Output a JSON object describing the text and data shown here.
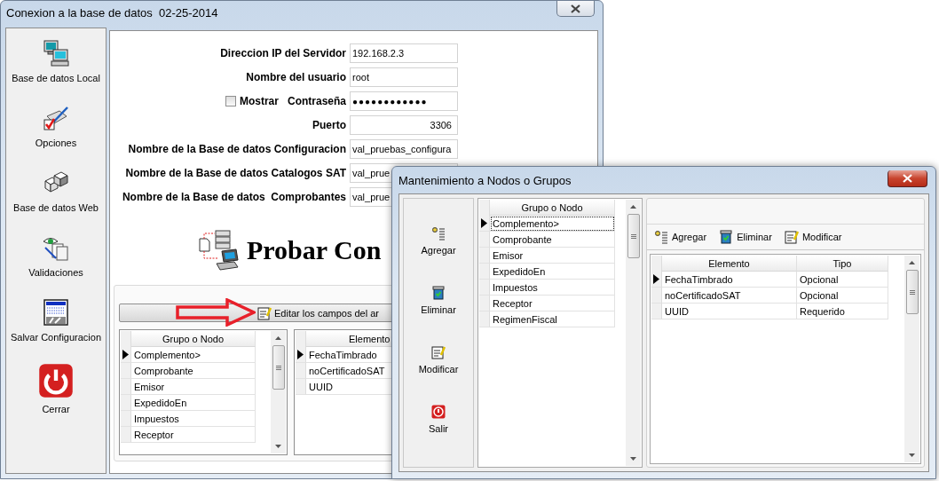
{
  "main_window": {
    "title": "Conexion a la base de datos  02-25-2014",
    "sidebar": [
      {
        "label": "Base de datos Local",
        "kind": "local"
      },
      {
        "label": "Opciones",
        "kind": "options"
      },
      {
        "label": "Base de datos Web",
        "kind": "web"
      },
      {
        "label": "Validaciones",
        "kind": "validation"
      },
      {
        "label": "Salvar Configuracion",
        "kind": "save"
      },
      {
        "label": "Cerrar",
        "kind": "close"
      }
    ],
    "form": [
      {
        "label": "Direccion IP del Servidor",
        "value": "192.168.2.3",
        "kind": "text"
      },
      {
        "label": "Nombre del usuario",
        "value": "root",
        "kind": "text"
      },
      {
        "label": "Contraseña",
        "value": "●●●●●●●●●●●●",
        "kind": "password",
        "toggle": {
          "label": "Mostrar",
          "checked": false
        }
      },
      {
        "label": "Puerto",
        "value": "3306",
        "kind": "number"
      },
      {
        "label": "Nombre de la Base de datos Configuracion",
        "value": "val_pruebas_configura",
        "kind": "text"
      },
      {
        "label": "Nombre de la Base de datos Catalogos SAT",
        "value": "val_prue",
        "kind": "text"
      },
      {
        "label": "Nombre de la Base de datos  Comprobantes",
        "value": "val_prue",
        "kind": "text"
      }
    ],
    "test_button": {
      "label": "Probar Con"
    },
    "edit_button": {
      "label": "Editar los campos del ar"
    },
    "groups_grid": {
      "columns": [
        "Grupo o Nodo"
      ],
      "rows": [
        {
          "cells": [
            "Complemento>"
          ],
          "selected": true
        },
        {
          "cells": [
            "Comprobante"
          ],
          "selected": false
        },
        {
          "cells": [
            "Emisor"
          ],
          "selected": false
        },
        {
          "cells": [
            "ExpedidoEn"
          ],
          "selected": false
        },
        {
          "cells": [
            "Impuestos"
          ],
          "selected": false
        },
        {
          "cells": [
            "Receptor"
          ],
          "selected": false
        }
      ]
    },
    "elements_grid": {
      "columns": [
        "Elemento"
      ],
      "rows": [
        {
          "cells": [
            "FechaTimbrado"
          ],
          "selected": true
        },
        {
          "cells": [
            "noCertificadoSAT"
          ],
          "selected": false
        },
        {
          "cells": [
            "UUID"
          ],
          "selected": false
        }
      ]
    }
  },
  "dialog": {
    "title": "Mantenimiento a Nodos o Grupos",
    "sidebar": [
      {
        "label": "Agregar",
        "kind": "add"
      },
      {
        "label": "Eliminar",
        "kind": "delete"
      },
      {
        "label": "Modificar",
        "kind": "edit"
      },
      {
        "label": "Salir",
        "kind": "exit"
      }
    ],
    "groups_grid": {
      "columns": [
        "Grupo o Nodo"
      ],
      "rows": [
        {
          "cells": [
            "Complemento>"
          ],
          "selected": true
        },
        {
          "cells": [
            "Comprobante"
          ],
          "selected": false
        },
        {
          "cells": [
            "Emisor"
          ],
          "selected": false
        },
        {
          "cells": [
            "ExpedidoEn"
          ],
          "selected": false
        },
        {
          "cells": [
            "Impuestos"
          ],
          "selected": false
        },
        {
          "cells": [
            "Receptor"
          ],
          "selected": false
        },
        {
          "cells": [
            "RegimenFiscal"
          ],
          "selected": false
        }
      ]
    },
    "toolbar": [
      {
        "label": "Agregar",
        "kind": "add"
      },
      {
        "label": "Eliminar",
        "kind": "delete"
      },
      {
        "label": "Modificar",
        "kind": "edit"
      }
    ],
    "elements_grid": {
      "columns": [
        "Elemento",
        "Tipo"
      ],
      "rows": [
        {
          "cells": [
            "FechaTimbrado",
            "Opcional"
          ],
          "selected": true
        },
        {
          "cells": [
            "noCertificadoSAT",
            "Opcional"
          ],
          "selected": false
        },
        {
          "cells": [
            "UUID",
            "Requerido"
          ],
          "selected": false
        }
      ]
    }
  }
}
